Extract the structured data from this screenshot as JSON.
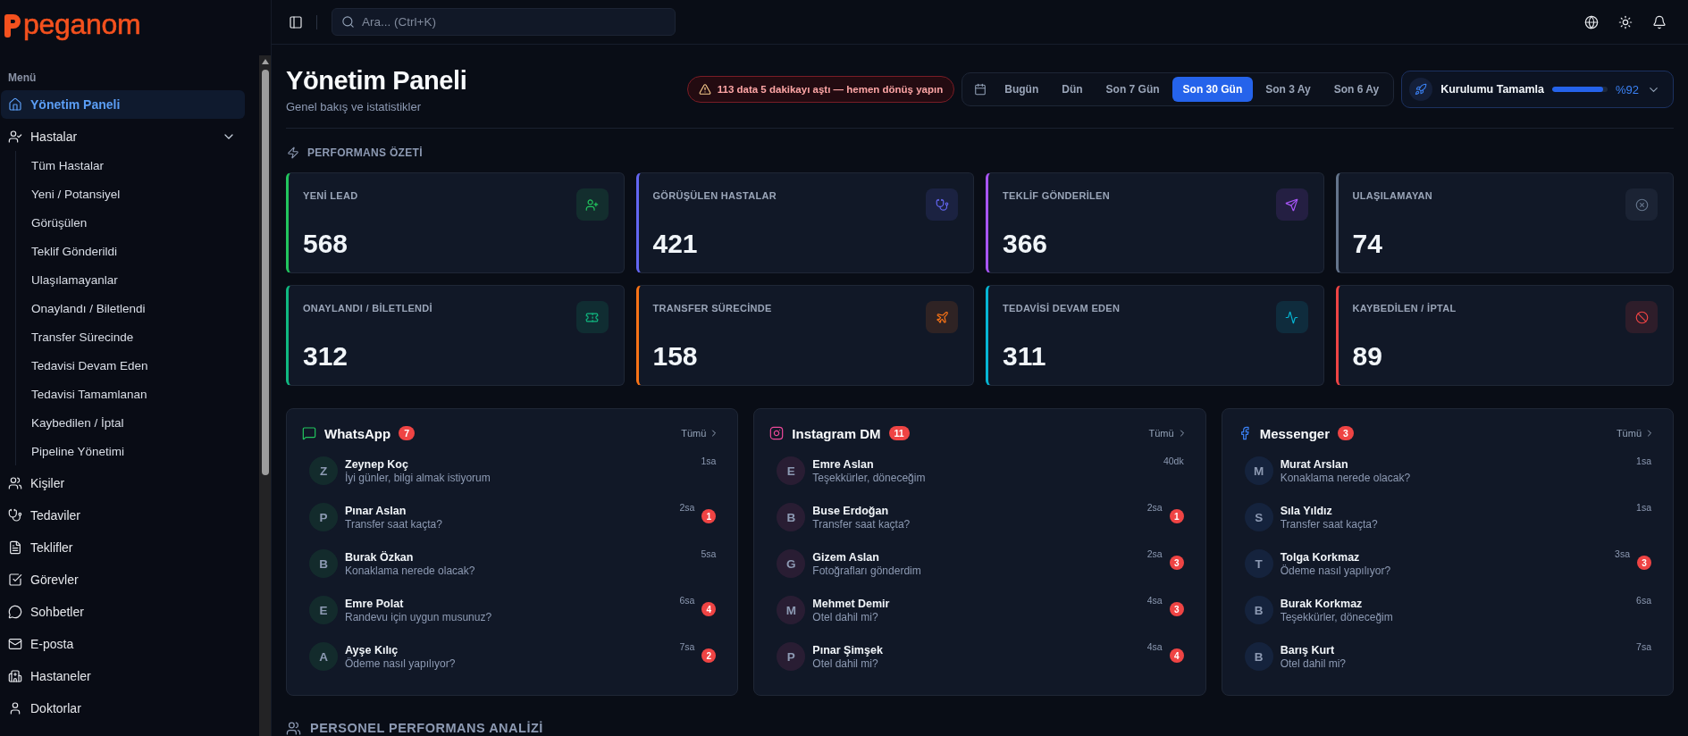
{
  "sidebar": {
    "logo": "peganom",
    "section_label": "Menü",
    "items": [
      {
        "label": "Yönetim Paneli",
        "selected": true
      },
      {
        "label": "Hastalar",
        "selected": false,
        "expanded": true,
        "children": [
          {
            "label": "Tüm Hastalar",
            "selected": false
          },
          {
            "label": "Yeni / Potansiyel",
            "selected": false
          },
          {
            "label": "Görüşülen",
            "selected": false
          },
          {
            "label": "Teklif Gönderildi",
            "selected": false
          },
          {
            "label": "Ulaşılamayanlar",
            "selected": false
          },
          {
            "label": "Onaylandı / Biletlendi",
            "selected": false
          },
          {
            "label": "Transfer Sürecinde",
            "selected": false
          },
          {
            "label": "Tedavisi Devam Eden",
            "selected": false
          },
          {
            "label": "Tedavisi Tamamlanan",
            "selected": false
          },
          {
            "label": "Kaybedilen / İptal",
            "selected": false
          },
          {
            "label": "Pipeline Yönetimi",
            "selected": false
          }
        ]
      },
      {
        "label": "Kişiler",
        "selected": false
      },
      {
        "label": "Tedaviler",
        "selected": false
      },
      {
        "label": "Teklifler",
        "selected": false
      },
      {
        "label": "Görevler",
        "selected": false
      },
      {
        "label": "Sohbetler",
        "selected": false
      },
      {
        "label": "E-posta",
        "selected": false
      },
      {
        "label": "Hastaneler",
        "selected": false
      },
      {
        "label": "Doktorlar",
        "selected": false
      }
    ]
  },
  "topbar": {
    "search": {
      "placeholder": "Ara... (Ctrl+K)"
    }
  },
  "header": {
    "title": "Yönetim Paneli",
    "subtitle": "Genel bakış ve istatistikler",
    "alert": "113 data 5 dakikayı aştı — hemen dönüş yapın",
    "date_ranges": [
      {
        "label": "Bugün",
        "selected": false
      },
      {
        "label": "Dün",
        "selected": false
      },
      {
        "label": "Son 7 Gün",
        "selected": false
      },
      {
        "label": "Son 30 Gün",
        "selected": true
      },
      {
        "label": "Son 3 Ay",
        "selected": false
      },
      {
        "label": "Son 6 Ay",
        "selected": false
      }
    ],
    "setup": {
      "label": "Kurulumu Tamamla",
      "level": 0.92,
      "reading": "%92"
    }
  },
  "performance": {
    "title": "PERFORMANS ÖZETİ",
    "cards": [
      {
        "label": "YENİ LEAD",
        "value": "568",
        "color": "#22c55e"
      },
      {
        "label": "GÖRÜŞÜLEN HASTALAR",
        "value": "421",
        "color": "#6366f1"
      },
      {
        "label": "TEKLİF GÖNDERİLEN",
        "value": "366",
        "color": "#a855f7"
      },
      {
        "label": "ULAŞILAMAYAN",
        "value": "74",
        "color": "#64748b"
      },
      {
        "label": "ONAYLANDI / BİLETLENDİ",
        "value": "312",
        "color": "#10b981"
      },
      {
        "label": "TRANSFER SÜRECİNDE",
        "value": "158",
        "color": "#f97316"
      },
      {
        "label": "TEDAVİSİ DEVAM EDEN",
        "value": "311",
        "color": "#06b6d4"
      },
      {
        "label": "KAYBEDİLEN / İPTAL",
        "value": "89",
        "color": "#ef4444"
      }
    ]
  },
  "channels": [
    {
      "title": "WhatsApp",
      "count": "7",
      "color": "#22c55e",
      "link": "Tümü",
      "conversations": [
        {
          "initial": "Z",
          "name": "Zeynep Koç",
          "message": "İyi günler, bilgi almak istiyorum",
          "time": "1sa"
        },
        {
          "initial": "P",
          "name": "Pınar Aslan",
          "message": "Transfer saat kaçta?",
          "time": "2sa",
          "unread": "1"
        },
        {
          "initial": "B",
          "name": "Burak Özkan",
          "message": "Konaklama nerede olacak?",
          "time": "5sa"
        },
        {
          "initial": "E",
          "name": "Emre Polat",
          "message": "Randevu için uygun musunuz?",
          "time": "6sa",
          "unread": "4"
        },
        {
          "initial": "A",
          "name": "Ayşe Kılıç",
          "message": "Ödeme nasıl yapılıyor?",
          "time": "7sa",
          "unread": "2"
        }
      ]
    },
    {
      "title": "Instagram DM",
      "count": "11",
      "color": "#ec4899",
      "link": "Tümü",
      "conversations": [
        {
          "initial": "E",
          "name": "Emre Aslan",
          "message": "Teşekkürler, döneceğim",
          "time": "40dk"
        },
        {
          "initial": "B",
          "name": "Buse Erdoğan",
          "message": "Transfer saat kaçta?",
          "time": "2sa",
          "unread": "1"
        },
        {
          "initial": "G",
          "name": "Gizem Aslan",
          "message": "Fotoğrafları gönderdim",
          "time": "2sa",
          "unread": "3"
        },
        {
          "initial": "M",
          "name": "Mehmet Demir",
          "message": "Otel dahil mi?",
          "time": "4sa",
          "unread": "3"
        },
        {
          "initial": "P",
          "name": "Pınar Şimşek",
          "message": "Otel dahil mi?",
          "time": "4sa",
          "unread": "4"
        }
      ]
    },
    {
      "title": "Messenger",
      "count": "3",
      "color": "#3b82f6",
      "link": "Tümü",
      "conversations": [
        {
          "initial": "M",
          "name": "Murat Arslan",
          "message": "Konaklama nerede olacak?",
          "time": "1sa"
        },
        {
          "initial": "S",
          "name": "Sıla Yıldız",
          "message": "Transfer saat kaçta?",
          "time": "1sa"
        },
        {
          "initial": "T",
          "name": "Tolga Korkmaz",
          "message": "Ödeme nasıl yapılıyor?",
          "time": "3sa",
          "unread": "3"
        },
        {
          "initial": "B",
          "name": "Burak Korkmaz",
          "message": "Teşekkürler, döneceğim",
          "time": "6sa"
        },
        {
          "initial": "B",
          "name": "Barış Kurt",
          "message": "Otel dahil mi?",
          "time": "7sa"
        }
      ]
    }
  ],
  "staff_section": {
    "title": "PERSONEL PERFORMANS ANALİZİ"
  }
}
